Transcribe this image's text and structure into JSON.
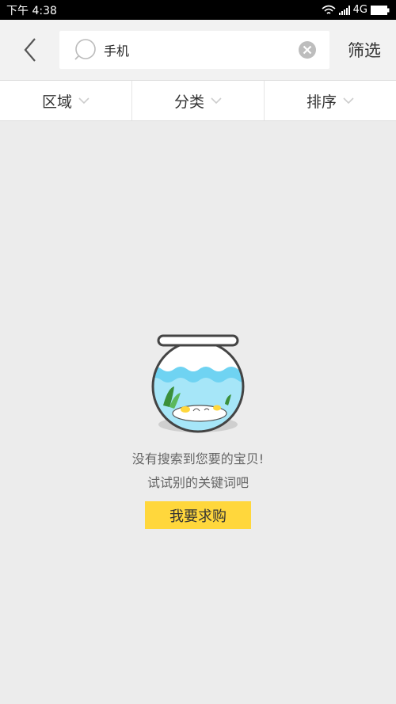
{
  "status_bar": {
    "time": "下午 4:38",
    "network": "4G"
  },
  "header": {
    "search_value": "手机",
    "filter_label": "筛选"
  },
  "filter_tabs": [
    {
      "label": "区域"
    },
    {
      "label": "分类"
    },
    {
      "label": "排序"
    }
  ],
  "empty_state": {
    "line1": "没有搜索到您要的宝贝!",
    "line2": "试试别的关键词吧",
    "button_label": "我要求购"
  },
  "colors": {
    "accent": "#ffd73c",
    "background": "#ececec",
    "water": "#6fd3f2"
  }
}
